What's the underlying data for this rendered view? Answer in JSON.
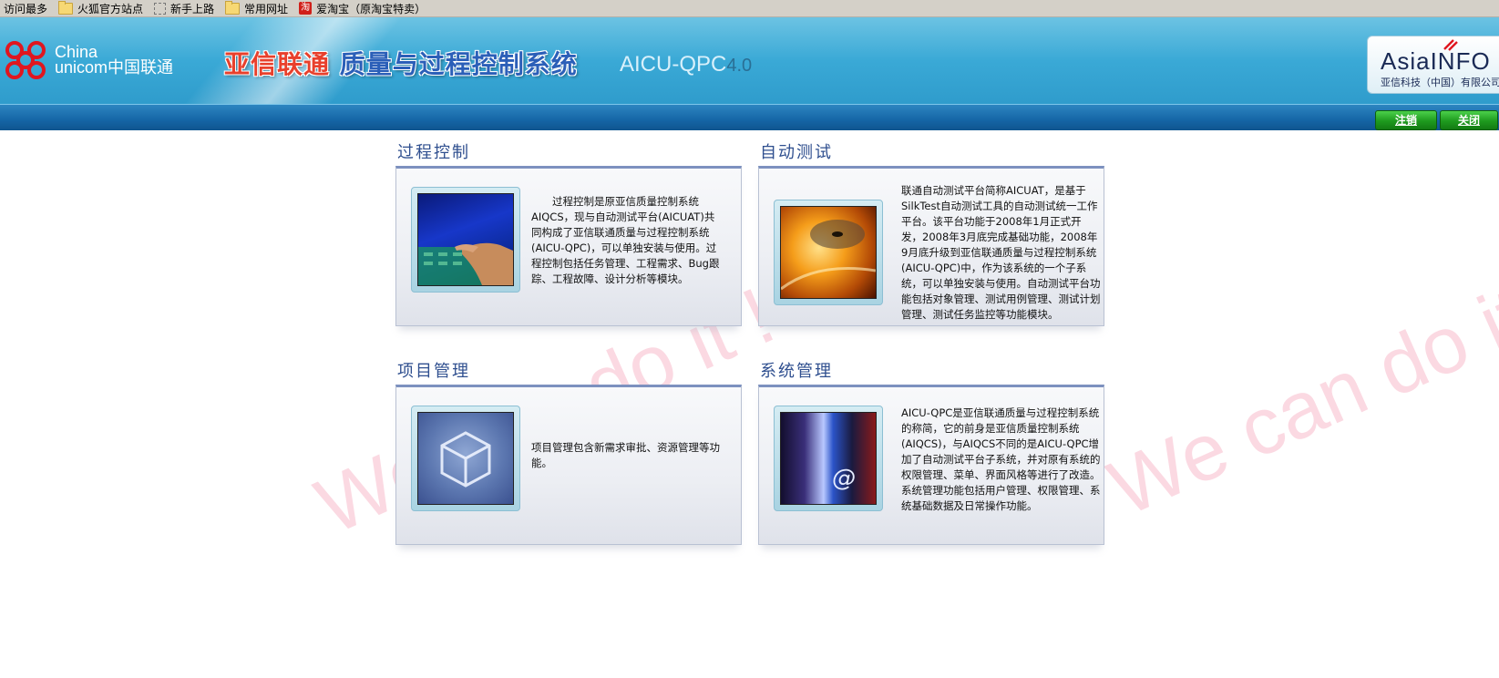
{
  "bookmarks": [
    {
      "label": "访问最多",
      "icon": "none"
    },
    {
      "label": "火狐官方站点",
      "icon": "folder-icon"
    },
    {
      "label": "新手上路",
      "icon": "dashed-page-icon"
    },
    {
      "label": "常用网址",
      "icon": "folder-icon"
    },
    {
      "label": "爱淘宝（原淘宝特卖）",
      "icon": "taobao-icon"
    }
  ],
  "header": {
    "brand_line1": "China",
    "brand_line2": "unicom中国联通",
    "system_title_red": "亚信联通",
    "system_title_blue": "质量与过程控制系统",
    "product": "AICU-QPC",
    "version": "4.0",
    "partner_name": "AsiaINFO",
    "partner_sub": "亚信科技（中国）有限公司",
    "background_color": "#3aa9d6"
  },
  "nav": {
    "logout_label": "注销",
    "close_label": "关闭",
    "button_color": "#1e9a1e"
  },
  "watermark": "We can do it !",
  "panels": [
    {
      "title": "过程控制",
      "text": "　　过程控制是原亚信质量控制系统AIQCS，现与自动测试平台(AICUAT)共同构成了亚信联通质量与过程控制系统(AICU-QPC)，可以单独安装与使用。过程控制包括任务管理、工程需求、Bug跟踪、工程故障、设计分析等模块。",
      "image": "touchscreen-image"
    },
    {
      "title": "自动测试",
      "text": "联通自动测试平台简称AICUAT，是基于SilkTest自动测试工具的自动测试统一工作平台。该平台功能于2008年1月正式开发，2008年3月底完成基础功能，2008年9月底升级到亚信联通质量与过程控制系统(AICU-QPC)中，作为该系统的一个子系统，可以单独安装与使用。自动测试平台功能包括对象管理、测试用例管理、测试计划管理、测试任务监控等功能模块。",
      "image": "cd-disc-image"
    },
    {
      "title": "项目管理",
      "text": "项目管理包含新需求审批、资源管理等功能。",
      "image": "cube-image"
    },
    {
      "title": "系统管理",
      "text": "AICU-QPC是亚信联通质量与过程控制系统的称简，它的前身是亚信质量控制系统(AIQCS)，与AIQCS不同的是AICU-QPC增加了自动测试平台子系统，并对原有系统的权限管理、菜单、界面风格等进行了改造。系统管理功能包括用户管理、权限管理、系统基础数据及日常操作功能。",
      "image": "at-sign-image"
    }
  ]
}
